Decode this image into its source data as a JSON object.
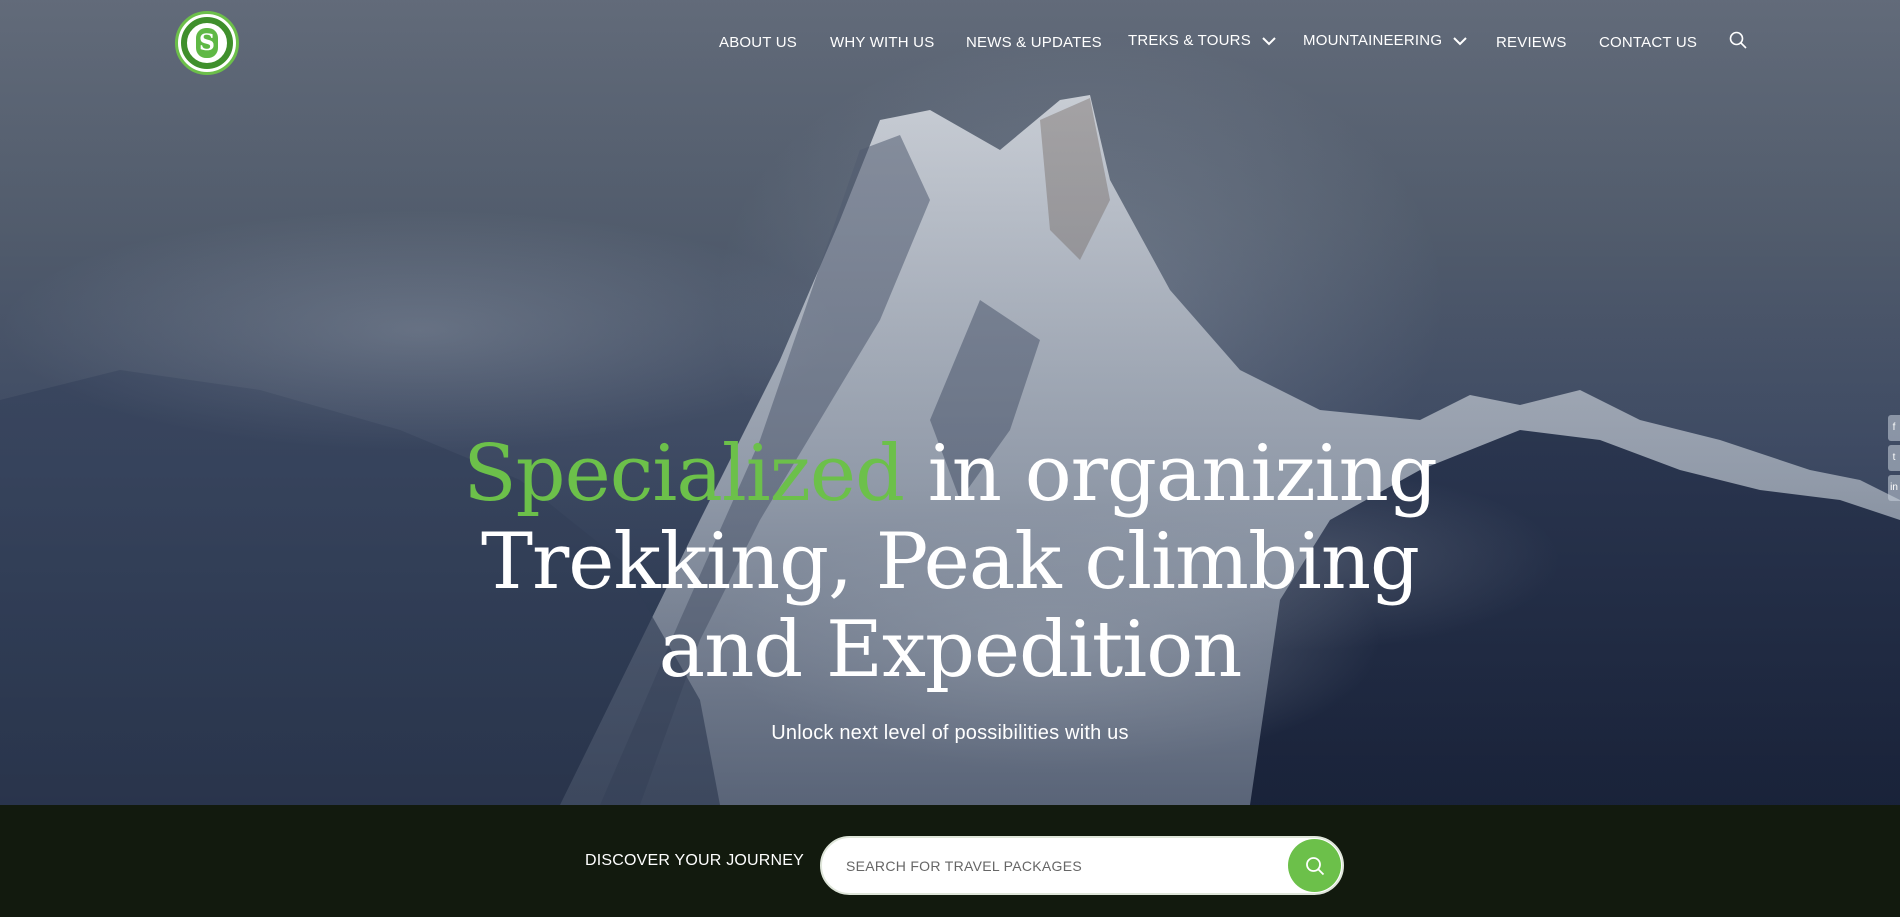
{
  "brand": {
    "logo_name": "Shanti Shangri Outdoor logo",
    "accent_color": "#6cc04a"
  },
  "nav": {
    "items": [
      {
        "label": "ABOUT US"
      },
      {
        "label": "WHY WITH US"
      },
      {
        "label": "NEWS & UPDATES"
      },
      {
        "label": "TREKS & TOURS",
        "has_dropdown": true
      },
      {
        "label": "MOUNTAINEERING",
        "has_dropdown": true
      },
      {
        "label": "REVIEWS"
      },
      {
        "label": "CONTACT US"
      }
    ],
    "search_icon": "search-icon"
  },
  "hero": {
    "headline_accent": "Specialized",
    "headline_line1_rest": " in organizing",
    "headline_line2": "Trekking, Peak climbing",
    "headline_line3": "and Expedition",
    "subtitle": "Unlock next level of possibilities with us"
  },
  "discover": {
    "label": "DISCOVER YOUR JOURNEY",
    "search_placeholder": "SEARCH FOR TRAVEL PACKAGES",
    "button_icon": "search-icon"
  },
  "side_social": [
    "facebook-icon",
    "twitter-icon",
    "linkedin-icon"
  ]
}
